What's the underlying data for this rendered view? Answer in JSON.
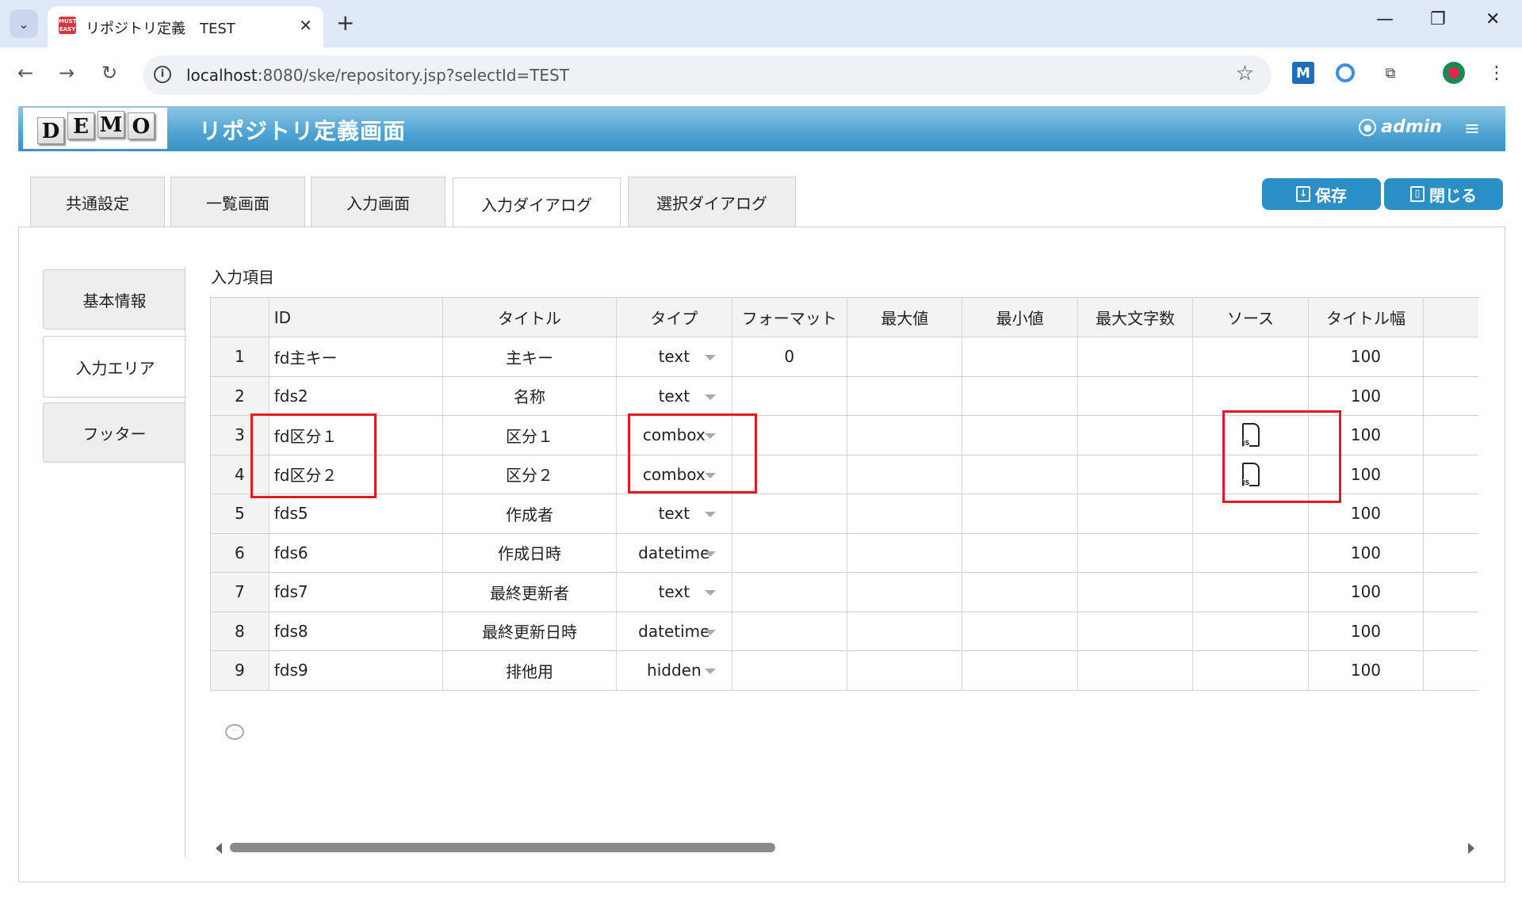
{
  "browser": {
    "tab_title": "リポジトリ定義　TEST",
    "favicon_text": "EASY",
    "url_host": "localhost",
    "url_rest": ":8080/ske/repository.jsp?selectId=TEST"
  },
  "header": {
    "logo_letters": [
      "D",
      "E",
      "M",
      "O"
    ],
    "title": "リポジトリ定義画面",
    "user": "admin"
  },
  "tabs": [
    {
      "label": "共通設定"
    },
    {
      "label": "一覧画面"
    },
    {
      "label": "入力画面"
    },
    {
      "label": "入力ダイアログ"
    },
    {
      "label": "選択ダイアログ"
    }
  ],
  "active_tab": "入力ダイアログ",
  "actions": {
    "save": "保存",
    "close": "閉じる"
  },
  "side_tabs": [
    {
      "label": "基本情報"
    },
    {
      "label": "入力エリア"
    },
    {
      "label": "フッター"
    }
  ],
  "active_side_tab": "入力エリア",
  "section_label": "入力項目",
  "grid": {
    "columns": [
      "",
      "ID",
      "タイトル",
      "タイプ",
      "フォーマット",
      "最大値",
      "最小値",
      "最大文字数",
      "ソース",
      "タイトル幅"
    ],
    "rows": [
      {
        "no": "1",
        "id": "fd主キー",
        "title": "主キー",
        "type": "text",
        "format": "0",
        "max": "",
        "min": "",
        "maxlen": "",
        "source": "",
        "title_width": "100"
      },
      {
        "no": "2",
        "id": "fds2",
        "title": "名称",
        "type": "text",
        "format": "",
        "max": "",
        "min": "",
        "maxlen": "",
        "source": "",
        "title_width": "100"
      },
      {
        "no": "3",
        "id": "fd区分１",
        "title": "区分１",
        "type": "combox",
        "format": "",
        "max": "",
        "min": "",
        "maxlen": "",
        "source": "JS",
        "title_width": "100"
      },
      {
        "no": "4",
        "id": "fd区分２",
        "title": "区分２",
        "type": "combox",
        "format": "",
        "max": "",
        "min": "",
        "maxlen": "",
        "source": "JS",
        "title_width": "100"
      },
      {
        "no": "5",
        "id": "fds5",
        "title": "作成者",
        "type": "text",
        "format": "",
        "max": "",
        "min": "",
        "maxlen": "",
        "source": "",
        "title_width": "100"
      },
      {
        "no": "6",
        "id": "fds6",
        "title": "作成日時",
        "type": "datetime",
        "format": "",
        "max": "",
        "min": "",
        "maxlen": "",
        "source": "",
        "title_width": "100"
      },
      {
        "no": "7",
        "id": "fds7",
        "title": "最終更新者",
        "type": "text",
        "format": "",
        "max": "",
        "min": "",
        "maxlen": "",
        "source": "",
        "title_width": "100"
      },
      {
        "no": "8",
        "id": "fds8",
        "title": "最終更新日時",
        "type": "datetime",
        "format": "",
        "max": "",
        "min": "",
        "maxlen": "",
        "source": "",
        "title_width": "100"
      },
      {
        "no": "9",
        "id": "fds9",
        "title": "排他用",
        "type": "hidden",
        "format": "",
        "max": "",
        "min": "",
        "maxlen": "",
        "source": "",
        "title_width": "100"
      }
    ]
  },
  "colors": {
    "header_blue": "#4ea3d2",
    "button_blue": "#2a8fc6",
    "highlight_red": "#e01b24"
  }
}
